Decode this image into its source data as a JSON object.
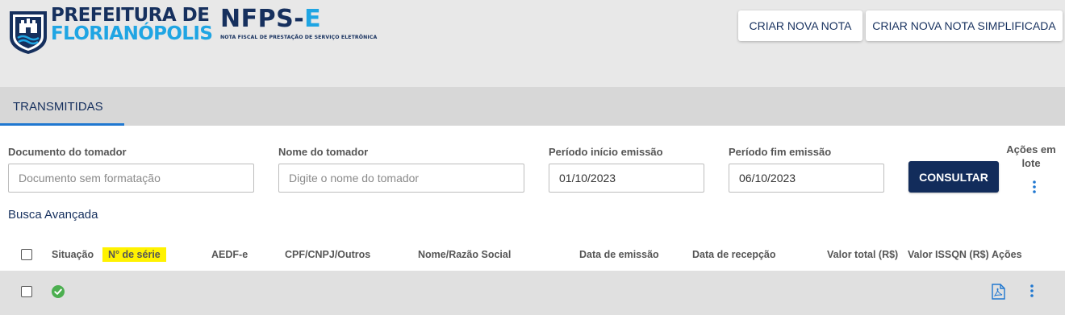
{
  "header": {
    "logo_line1": "PREFEITURA DE",
    "logo_line2": "FLORIANÓPOLIS",
    "nfps_main": "NFPS-",
    "nfps_e": "E",
    "nfps_subtitle": "NOTA FISCAL DE PRESTAÇÃO DE SERVIÇO ELETRÔNICA",
    "btn_nova": "CRIAR NOVA NOTA",
    "btn_simplificada": "CRIAR NOVA NOTA SIMPLIFICADA"
  },
  "tabs": [
    {
      "label": "TRANSMITIDAS",
      "active": true
    }
  ],
  "filters": {
    "documento": {
      "label": "Documento do tomador",
      "placeholder": "Documento sem formatação",
      "value": ""
    },
    "nome": {
      "label": "Nome do tomador",
      "placeholder": "Digite o nome do tomador",
      "value": ""
    },
    "inicio": {
      "label": "Período início emissão",
      "value": "01/10/2023"
    },
    "fim": {
      "label": "Período fim emissão",
      "value": "06/10/2023"
    },
    "consultar": "CONSULTAR",
    "acoes_lote": "Ações em lote",
    "busca_avancada": "Busca Avançada"
  },
  "table": {
    "columns": [
      "Situação",
      "N° de série",
      "AEDF-e",
      "CPF/CNPJ/Outros",
      "Nome/Razão Social",
      "Data de emissão",
      "Data de recepção",
      "Valor total (R$)",
      "Valor ISSQN (R$)",
      "Ações"
    ],
    "rows": [
      {
        "status": "check-circle-icon",
        "actions": [
          "pdf-icon",
          "more-vert-icon"
        ]
      }
    ]
  },
  "colors": {
    "brand_navy": "#16305e",
    "brand_blue": "#1fa5e3",
    "tab_underline": "#1f77d0",
    "highlight": "#fff200",
    "status_ok": "#4caf50"
  }
}
